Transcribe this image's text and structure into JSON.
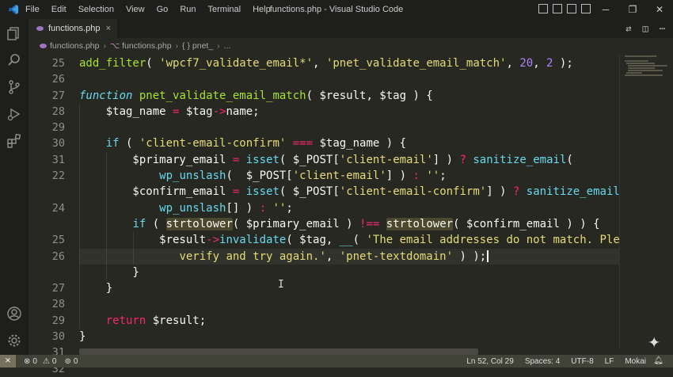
{
  "window": {
    "title": "functions.php - Visual Studio Code",
    "menu": [
      "File",
      "Edit",
      "Selection",
      "View",
      "Go",
      "Run",
      "Terminal",
      "Help"
    ]
  },
  "tab": {
    "label": "functions.php",
    "close": "×"
  },
  "breadcrumb": {
    "file": "functions.php",
    "func": "functions.php",
    "ns": "{ } pnet_",
    "more": "..."
  },
  "code": {
    "line_numbers": [
      "25",
      "26",
      "27",
      "28",
      "29",
      "30",
      "31",
      "22",
      "",
      "24",
      "",
      "25",
      "26",
      "",
      "27",
      "28",
      "29",
      "30",
      "31",
      "32"
    ],
    "lines": [
      [
        {
          "t": "add_filter",
          "c": "fn"
        },
        {
          "t": "( ",
          "c": "v"
        },
        {
          "t": "'wpcf7_validate_email*'",
          "c": "s"
        },
        {
          "t": ", ",
          "c": "v"
        },
        {
          "t": "'pnet_validate_email_match'",
          "c": "s"
        },
        {
          "t": ", ",
          "c": "v"
        },
        {
          "t": "20",
          "c": "n"
        },
        {
          "t": ", ",
          "c": "v"
        },
        {
          "t": "2",
          "c": "n"
        },
        {
          "t": " );",
          "c": "v"
        }
      ],
      [],
      [
        {
          "t": "function",
          "c": "kw"
        },
        {
          "t": " ",
          "c": "v"
        },
        {
          "t": "pnet_validate_email_match",
          "c": "fn"
        },
        {
          "t": "( $result, $tag ) {",
          "c": "v"
        }
      ],
      [
        {
          "t": "    $tag_name ",
          "c": "v"
        },
        {
          "t": "=",
          "c": "op"
        },
        {
          "t": " $tag",
          "c": "v"
        },
        {
          "t": "->",
          "c": "op"
        },
        {
          "t": "name;",
          "c": "v"
        }
      ],
      [],
      [
        {
          "t": "    ",
          "c": "v"
        },
        {
          "t": "if",
          "c": "kw plain"
        },
        {
          "t": " ( ",
          "c": "v"
        },
        {
          "t": "'client-email-confirm'",
          "c": "s"
        },
        {
          "t": " ",
          "c": "v"
        },
        {
          "t": "===",
          "c": "op"
        },
        {
          "t": " $tag_name ) {",
          "c": "v"
        }
      ],
      [
        {
          "t": "        $primary_email ",
          "c": "v"
        },
        {
          "t": "=",
          "c": "op"
        },
        {
          "t": " ",
          "c": "v"
        },
        {
          "t": "isset",
          "c": "kw plain"
        },
        {
          "t": "( $_POST[",
          "c": "v"
        },
        {
          "t": "'client-email'",
          "c": "s"
        },
        {
          "t": "] ) ",
          "c": "v"
        },
        {
          "t": "?",
          "c": "op"
        },
        {
          "t": " ",
          "c": "v"
        },
        {
          "t": "sanitize_email",
          "c": "kw plain"
        },
        {
          "t": "(",
          "c": "v"
        }
      ],
      [
        {
          "t": "            ",
          "c": "v"
        },
        {
          "t": "wp_unslash",
          "c": "kw plain"
        },
        {
          "t": "(  $_POST[",
          "c": "v"
        },
        {
          "t": "'client-email'",
          "c": "s"
        },
        {
          "t": "] ) ",
          "c": "v"
        },
        {
          "t": ":",
          "c": "op"
        },
        {
          "t": " ",
          "c": "v"
        },
        {
          "t": "''",
          "c": "s"
        },
        {
          "t": ";",
          "c": "v"
        }
      ],
      [
        {
          "t": "        $confirm_email ",
          "c": "v"
        },
        {
          "t": "=",
          "c": "op"
        },
        {
          "t": " ",
          "c": "v"
        },
        {
          "t": "isset",
          "c": "kw plain"
        },
        {
          "t": "( $_POST[",
          "c": "v"
        },
        {
          "t": "'client-email-confirm'",
          "c": "s"
        },
        {
          "t": "] ) ",
          "c": "v"
        },
        {
          "t": "?",
          "c": "op"
        },
        {
          "t": " ",
          "c": "v"
        },
        {
          "t": "sanitize_email",
          "c": "kw plain"
        },
        {
          "t": "(",
          "c": "v"
        }
      ],
      [
        {
          "t": "            ",
          "c": "v"
        },
        {
          "t": "wp_unslash",
          "c": "kw plain"
        },
        {
          "t": "[] ) ",
          "c": "v"
        },
        {
          "t": ":",
          "c": "op"
        },
        {
          "t": " ",
          "c": "v"
        },
        {
          "t": "''",
          "c": "s"
        },
        {
          "t": ";",
          "c": "v"
        }
      ],
      [
        {
          "t": "        ",
          "c": "v"
        },
        {
          "t": "if",
          "c": "kw plain"
        },
        {
          "t": " ( ",
          "c": "v"
        },
        {
          "t": "strtolower",
          "c": "v hl"
        },
        {
          "t": "( $primary_email ) ",
          "c": "v"
        },
        {
          "t": "!==",
          "c": "op"
        },
        {
          "t": " ",
          "c": "v"
        },
        {
          "t": "strtolower",
          "c": "v hl"
        },
        {
          "t": "( $confirm_email ) ) {",
          "c": "v"
        }
      ],
      [
        {
          "t": "            $result",
          "c": "v"
        },
        {
          "t": "->",
          "c": "op"
        },
        {
          "t": "invalidate",
          "c": "kw plain"
        },
        {
          "t": "( $tag, ",
          "c": "v"
        },
        {
          "t": "__",
          "c": "kw plain"
        },
        {
          "t": "( ",
          "c": "v"
        },
        {
          "t": "'The email addresses do not match. Please",
          "c": "s"
        }
      ],
      [
        {
          "t": "               ",
          "c": "v"
        },
        {
          "t": "verify and try again.'",
          "c": "s"
        },
        {
          "t": ", ",
          "c": "v"
        },
        {
          "t": "'pnet-textdomain'",
          "c": "s"
        },
        {
          "t": " ) );",
          "c": "v"
        }
      ],
      [
        {
          "t": "        }",
          "c": "v"
        }
      ],
      [
        {
          "t": "    }",
          "c": "v"
        }
      ],
      [],
      [
        {
          "t": "    ",
          "c": "v"
        },
        {
          "t": "return",
          "c": "op"
        },
        {
          "t": " $result;",
          "c": "v"
        }
      ],
      [
        {
          "t": "}",
          "c": "v"
        }
      ],
      [],
      []
    ]
  },
  "status": {
    "remote": "⨯",
    "errors": "0",
    "warnings": "0",
    "ports": "0",
    "position": "Ln 52, Col 29",
    "spaces": "Spaces: 4",
    "encoding": "UTF-8",
    "eol": "LF",
    "theme": "Mokai"
  }
}
